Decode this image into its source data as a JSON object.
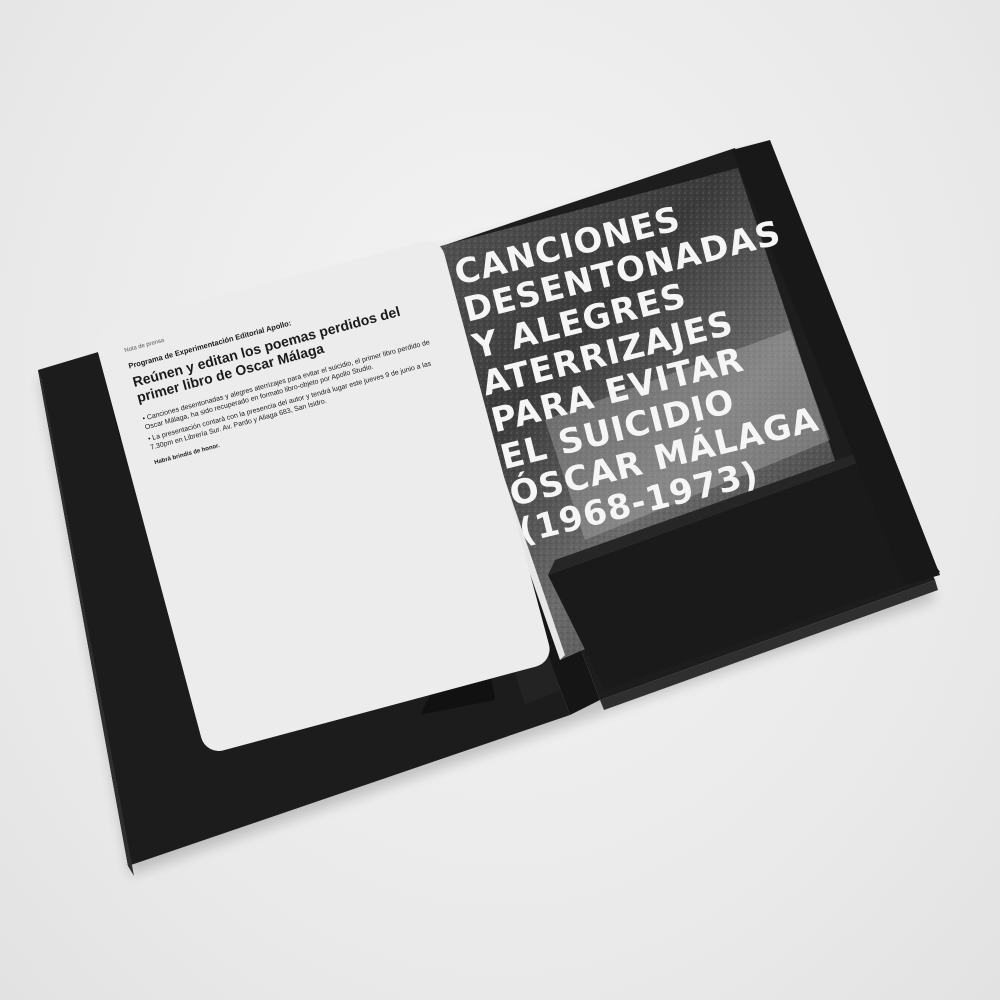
{
  "book_cover": {
    "title_lines": [
      "CANCIONES",
      "DESENTONADAS",
      "Y ALEGRES",
      "ATERRIZAJES",
      "PARA EVITAR",
      "EL SUICIDIO",
      "ÓSCAR MÁLAGA",
      "(1968-1973)"
    ]
  },
  "press_sheet": {
    "label": "Nota de prensa",
    "program": "Programa de Experimentación Editorial Apollo:",
    "headline": "Reúnen y editan los poemas perdidos del primer libro de Oscar Málaga",
    "bullets": [
      "• Canciones desentonadas y alegres aterrizajes para evitar el suicidio, el primer libro perdido de Oscar Málaga, ha sido recuperado en formato libro-objeto por Apollo Studio.",
      "• La presentación contará con la presencia del autor y tendrá lugar este jueves 9 de junio a las 7.30pm en Librería Sur. Av. Pardo y Aliaga 683, San Isidro."
    ],
    "closing": "Habrá brindis de honor."
  },
  "colors": {
    "folder": "#1b1b1b",
    "sheet": "#ececec",
    "background": "#ebebeb",
    "cover_text": "#f5f5f5"
  }
}
